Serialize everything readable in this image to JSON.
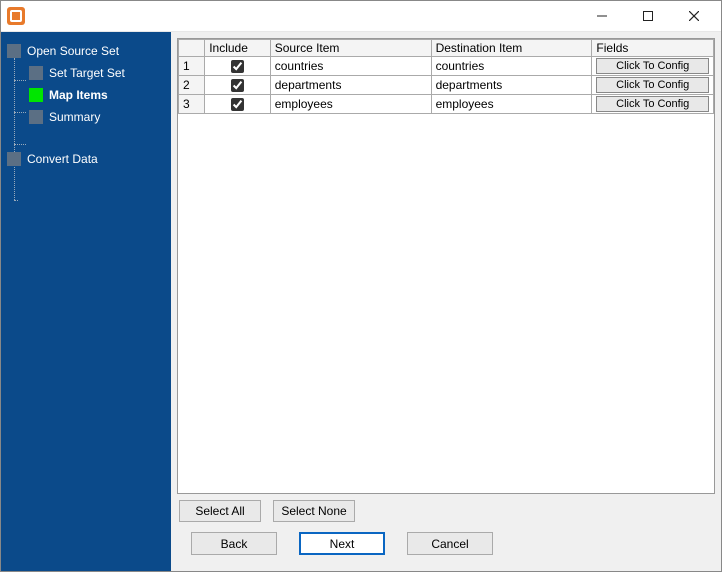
{
  "sidebar": {
    "root": {
      "label": "Open Source Set"
    },
    "items": [
      {
        "label": "Set Target Set",
        "active": false
      },
      {
        "label": "Map Items",
        "active": true,
        "bold": true
      },
      {
        "label": "Summary",
        "active": false
      }
    ],
    "last": {
      "label": "Convert Data"
    }
  },
  "table": {
    "headers": {
      "include": "Include",
      "source": "Source Item",
      "destination": "Destination Item",
      "fields": "Fields"
    },
    "rows": [
      {
        "idx": "1",
        "included": true,
        "source": "countries",
        "destination": "countries",
        "config_label": "Click To Config"
      },
      {
        "idx": "2",
        "included": true,
        "source": "departments",
        "destination": "departments",
        "config_label": "Click To Config"
      },
      {
        "idx": "3",
        "included": true,
        "source": "employees",
        "destination": "employees",
        "config_label": "Click To Config"
      }
    ]
  },
  "buttons": {
    "select_all": "Select All",
    "select_none": "Select None",
    "back": "Back",
    "next": "Next",
    "cancel": "Cancel"
  }
}
